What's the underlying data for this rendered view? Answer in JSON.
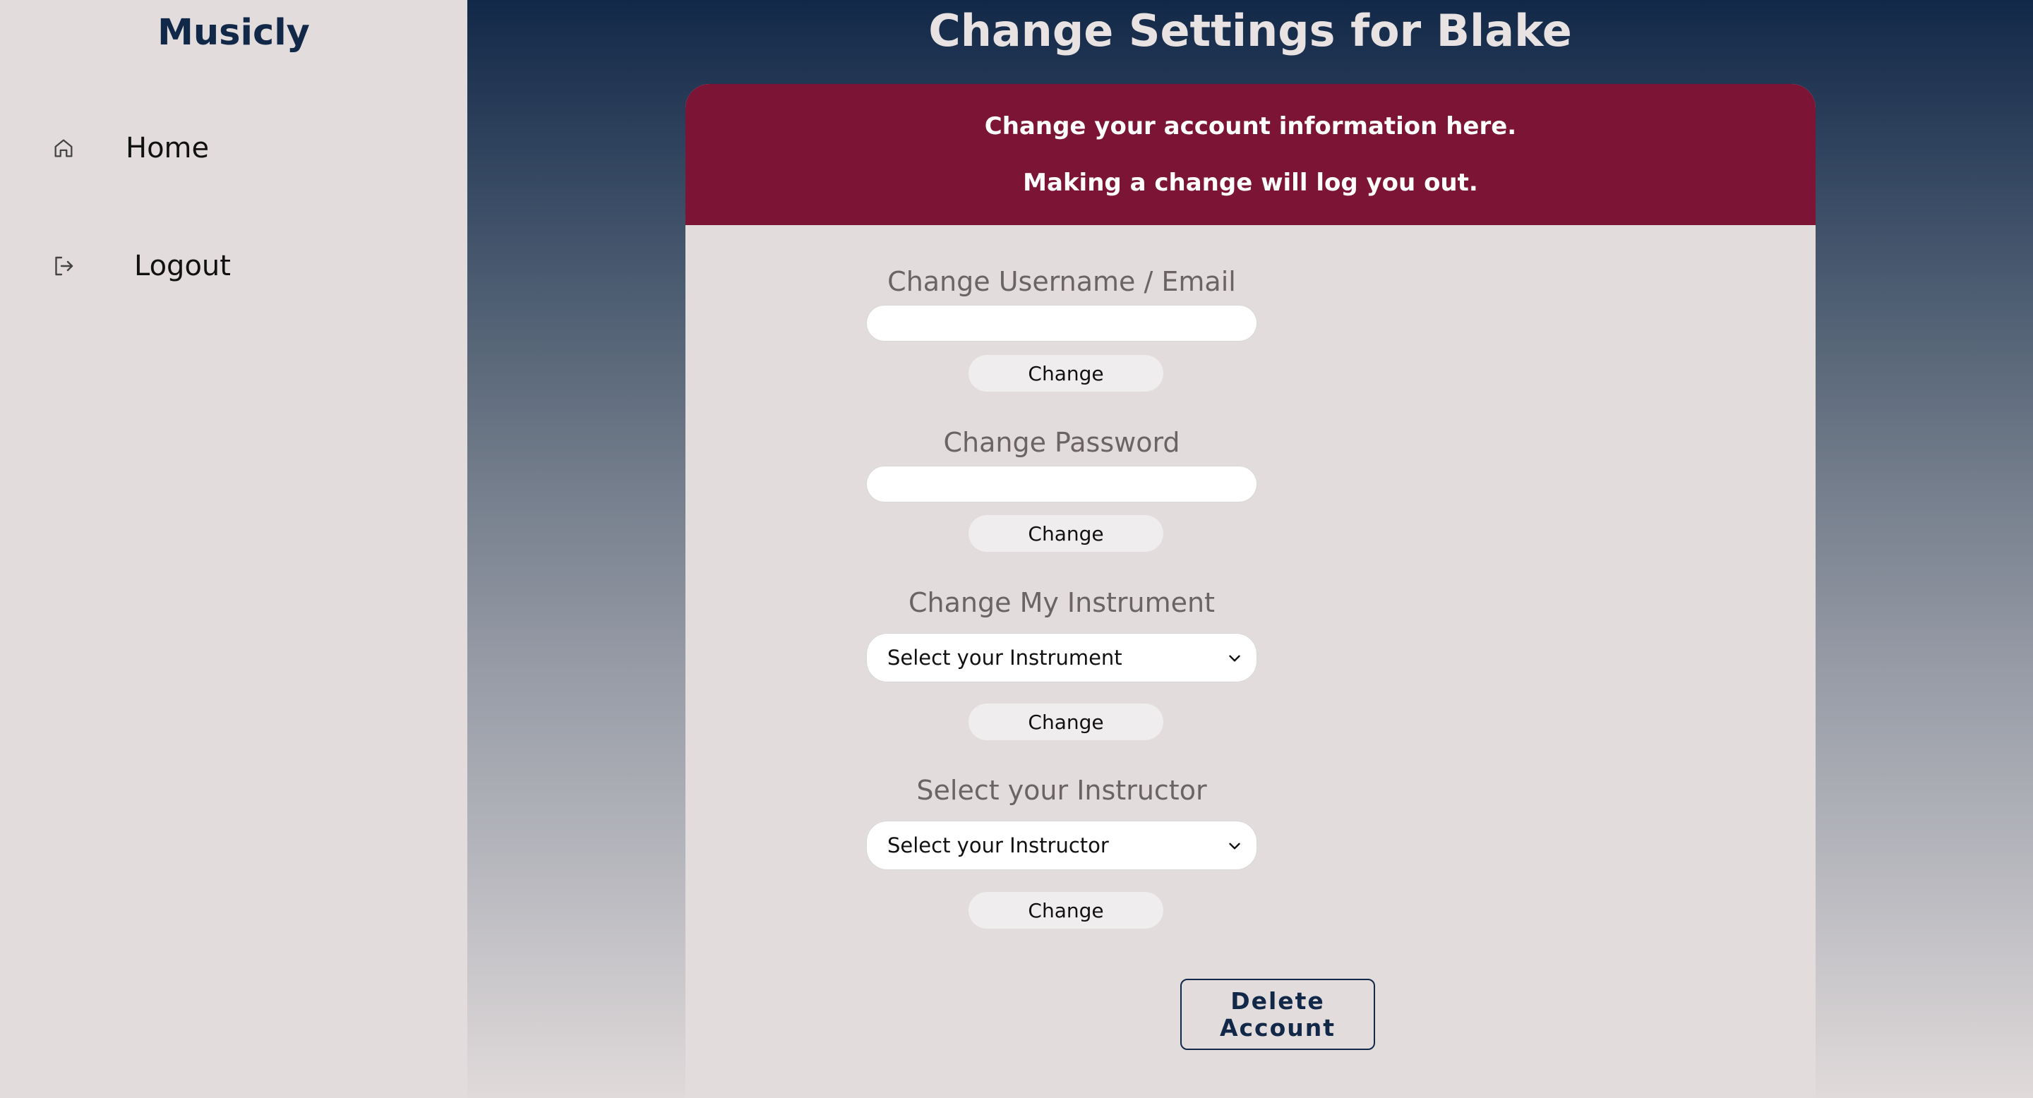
{
  "sidebar": {
    "brand": "Musicly",
    "items": [
      {
        "label": "Home",
        "icon": "home-icon"
      },
      {
        "label": "Logout",
        "icon": "logout-icon"
      }
    ]
  },
  "main": {
    "title": "Change Settings for Blake",
    "notice": {
      "line1": "Change your account information here.",
      "line2": "Making a change will log you out."
    },
    "sections": {
      "username": {
        "label": "Change Username / Email",
        "value": "",
        "button": "Change"
      },
      "password": {
        "label": "Change Password",
        "value": "",
        "button": "Change"
      },
      "instrument": {
        "label": "Change My Instrument",
        "selected": "Select your Instrument",
        "button": "Change"
      },
      "instructor": {
        "label": "Select your Instructor",
        "selected": "Select your Instructor",
        "button": "Change"
      }
    },
    "delete_button": "Delete Account"
  },
  "colors": {
    "brand_navy": "#122848",
    "header_maroon": "#7c1535",
    "panel_bg": "#e3dcdc"
  }
}
